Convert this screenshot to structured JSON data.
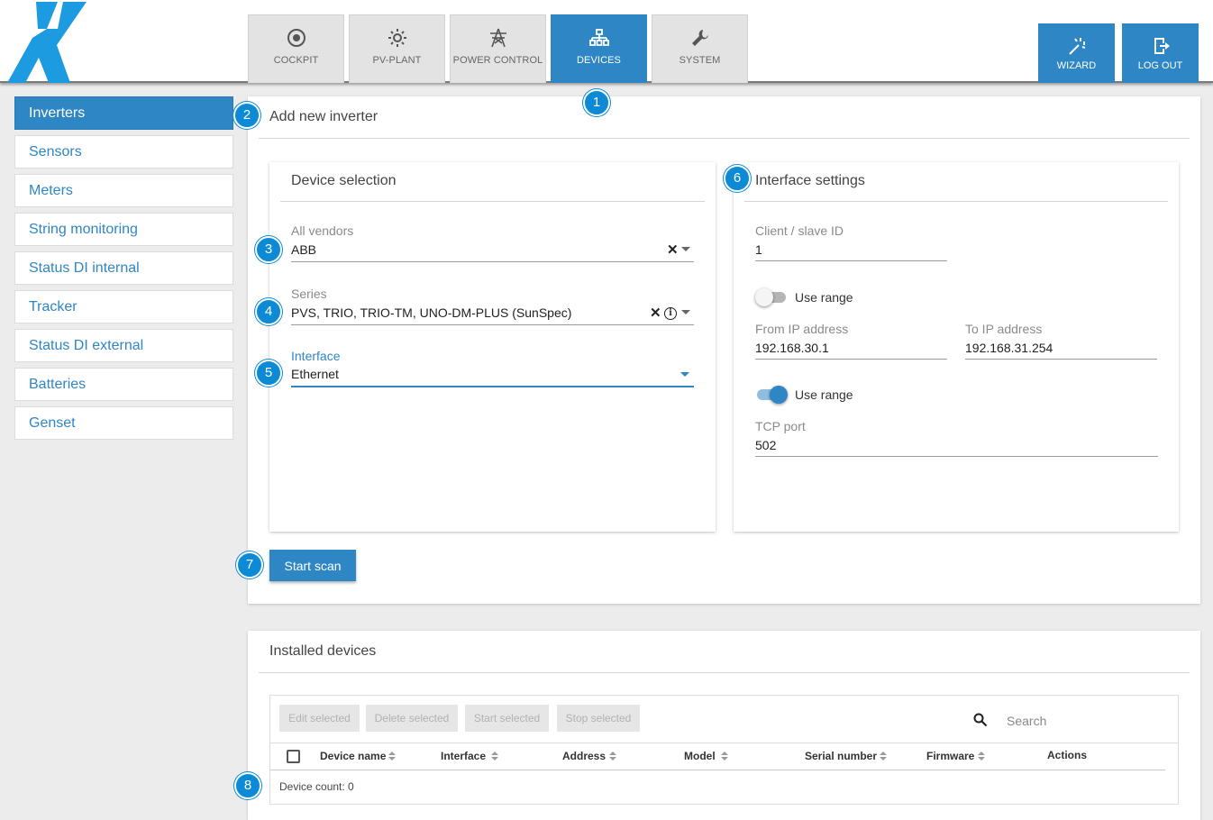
{
  "nav": {
    "tabs": [
      {
        "label": "COCKPIT",
        "icon": "target-icon"
      },
      {
        "label": "PV-PLANT",
        "icon": "sun-icon"
      },
      {
        "label": "POWER CONTROL",
        "icon": "power-tower-icon"
      },
      {
        "label": "DEVICES",
        "icon": "network-icon",
        "active": true
      },
      {
        "label": "SYSTEM",
        "icon": "wrench-icon"
      }
    ],
    "wizard_label": "WIZARD",
    "logout_label": "LOG OUT"
  },
  "sidebar": {
    "items": [
      {
        "label": "Inverters",
        "active": true
      },
      {
        "label": "Sensors"
      },
      {
        "label": "Meters"
      },
      {
        "label": "String monitoring"
      },
      {
        "label": "Status DI internal"
      },
      {
        "label": "Tracker"
      },
      {
        "label": "Status DI external"
      },
      {
        "label": "Batteries"
      },
      {
        "label": "Genset"
      }
    ]
  },
  "add_panel": {
    "title": "Add new inverter",
    "device_selection": {
      "title": "Device selection",
      "vendor_label": "All vendors",
      "vendor_value": "ABB",
      "series_label": "Series",
      "series_value": "PVS, TRIO, TRIO-TM, UNO-DM-PLUS (SunSpec)",
      "interface_label": "Interface",
      "interface_value": "Ethernet"
    },
    "interface_settings": {
      "title": "Interface settings",
      "client_id_label": "Client / slave ID",
      "client_id_value": "1",
      "use_range_1": {
        "label": "Use range",
        "on": false
      },
      "from_ip_label": "From IP address",
      "from_ip_value": "192.168.30.1",
      "to_ip_label": "To IP address",
      "to_ip_value": "192.168.31.254",
      "use_range_2": {
        "label": "Use range",
        "on": true
      },
      "tcp_port_label": "TCP port",
      "tcp_port_value": "502"
    },
    "start_scan_label": "Start scan"
  },
  "installed": {
    "title": "Installed devices",
    "toolbar": {
      "edit": "Edit selected",
      "delete": "Delete selected",
      "start": "Start selected",
      "stop": "Stop selected"
    },
    "search_placeholder": "Search",
    "columns": [
      "Device name",
      "Interface",
      "Address",
      "Model",
      "Serial number",
      "Firmware",
      "Actions"
    ],
    "device_count": "Device count: 0"
  },
  "callouts": [
    "1",
    "2",
    "3",
    "4",
    "5",
    "6",
    "7",
    "8"
  ],
  "colors": {
    "accent": "#2f86c5",
    "callout": "#0d8ad6",
    "background": "#ececec"
  }
}
